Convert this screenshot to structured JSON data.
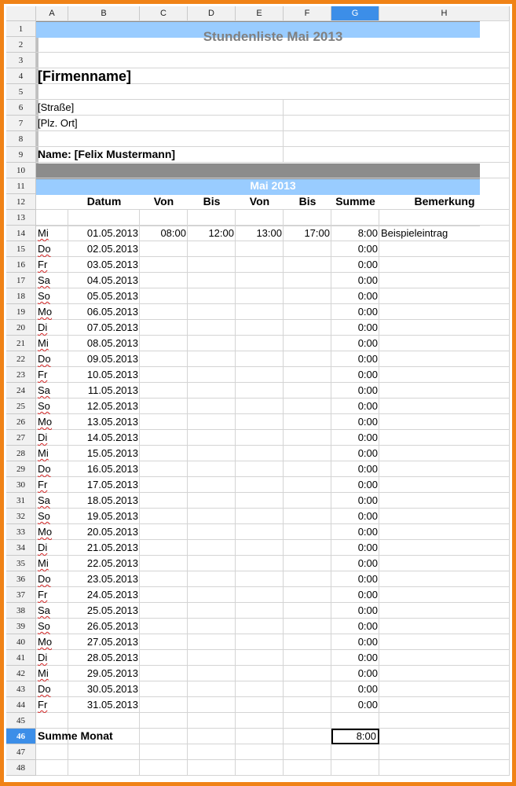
{
  "columns": [
    "A",
    "B",
    "C",
    "D",
    "E",
    "F",
    "G",
    "H"
  ],
  "selected_column": "G",
  "selected_row": "46",
  "title": "Stundenliste Mai 2013",
  "company": "[Firmenname]",
  "street": "[Straße]",
  "city": "[Plz. Ort]",
  "name_line": "Name: [Felix Mustermann]",
  "month_band": "Mai 2013",
  "headers": [
    "Datum",
    "Von",
    "Bis",
    "Von",
    "Bis",
    "Summe",
    "Bemerkung"
  ],
  "entries": [
    {
      "day": "Mi",
      "date": "01.05.2013",
      "von1": "08:00",
      "bis1": "12:00",
      "von2": "13:00",
      "bis2": "17:00",
      "sum": "8:00",
      "note": "Beispieleintrag"
    },
    {
      "day": "Do",
      "date": "02.05.2013",
      "sum": "0:00"
    },
    {
      "day": "Fr",
      "date": "03.05.2013",
      "sum": "0:00"
    },
    {
      "day": "Sa",
      "date": "04.05.2013",
      "sum": "0:00",
      "weekend": true
    },
    {
      "day": "So",
      "date": "05.05.2013",
      "sum": "0:00",
      "weekend": true
    },
    {
      "day": "Mo",
      "date": "06.05.2013",
      "sum": "0:00"
    },
    {
      "day": "Di",
      "date": "07.05.2013",
      "sum": "0:00"
    },
    {
      "day": "Mi",
      "date": "08.05.2013",
      "sum": "0:00"
    },
    {
      "day": "Do",
      "date": "09.05.2013",
      "sum": "0:00"
    },
    {
      "day": "Fr",
      "date": "10.05.2013",
      "sum": "0:00"
    },
    {
      "day": "Sa",
      "date": "11.05.2013",
      "sum": "0:00",
      "weekend": true
    },
    {
      "day": "So",
      "date": "12.05.2013",
      "sum": "0:00",
      "weekend": true
    },
    {
      "day": "Mo",
      "date": "13.05.2013",
      "sum": "0:00"
    },
    {
      "day": "Di",
      "date": "14.05.2013",
      "sum": "0:00"
    },
    {
      "day": "Mi",
      "date": "15.05.2013",
      "sum": "0:00"
    },
    {
      "day": "Do",
      "date": "16.05.2013",
      "sum": "0:00"
    },
    {
      "day": "Fr",
      "date": "17.05.2013",
      "sum": "0:00"
    },
    {
      "day": "Sa",
      "date": "18.05.2013",
      "sum": "0:00",
      "weekend": true
    },
    {
      "day": "So",
      "date": "19.05.2013",
      "sum": "0:00",
      "weekend": true
    },
    {
      "day": "Mo",
      "date": "20.05.2013",
      "sum": "0:00"
    },
    {
      "day": "Di",
      "date": "21.05.2013",
      "sum": "0:00"
    },
    {
      "day": "Mi",
      "date": "22.05.2013",
      "sum": "0:00"
    },
    {
      "day": "Do",
      "date": "23.05.2013",
      "sum": "0:00"
    },
    {
      "day": "Fr",
      "date": "24.05.2013",
      "sum": "0:00"
    },
    {
      "day": "Sa",
      "date": "25.05.2013",
      "sum": "0:00",
      "weekend": true
    },
    {
      "day": "So",
      "date": "26.05.2013",
      "sum": "0:00",
      "weekend": true
    },
    {
      "day": "Mo",
      "date": "27.05.2013",
      "sum": "0:00"
    },
    {
      "day": "Di",
      "date": "28.05.2013",
      "sum": "0:00"
    },
    {
      "day": "Mi",
      "date": "29.05.2013",
      "sum": "0:00"
    },
    {
      "day": "Do",
      "date": "30.05.2013",
      "sum": "0:00"
    },
    {
      "day": "Fr",
      "date": "31.05.2013",
      "sum": "0:00"
    }
  ],
  "total_label": "Summe Monat",
  "total_value": "8:00",
  "colors": {
    "frame": "#f08216",
    "band": "#8c8c8c",
    "header_row": "#99ccff",
    "weekend": "#c0c0c0",
    "selection": "#3c8ee8"
  }
}
